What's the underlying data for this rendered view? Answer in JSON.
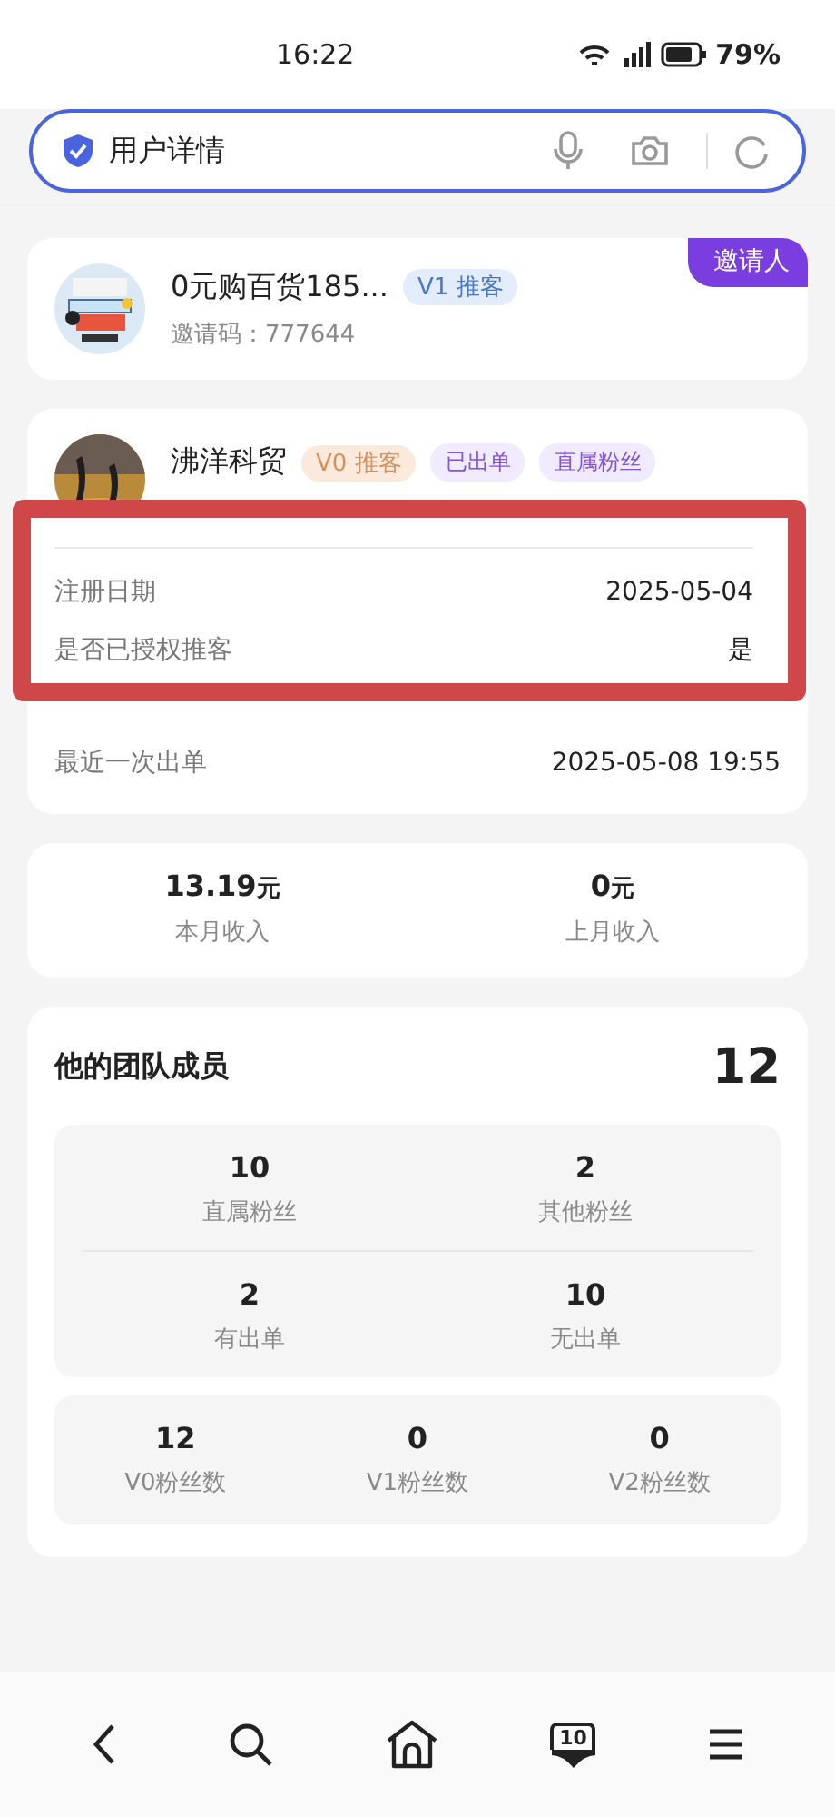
{
  "status_bar": {
    "time": "16:22",
    "battery": "79%"
  },
  "search": {
    "value": "用户详情"
  },
  "inviter": {
    "name": "0元购百货185...",
    "level": "V1",
    "role": "推客",
    "invite_code": "邀请码：777644",
    "ribbon": "邀请人"
  },
  "member": {
    "name": "沸洋科贸",
    "level": "V0",
    "role": "推客",
    "tags": [
      "已出单",
      "直属粉丝"
    ]
  },
  "highlight": {
    "rows": [
      {
        "label": "注册日期",
        "value": "2025-05-04"
      },
      {
        "label": "是否已授权推客",
        "value": "是"
      }
    ]
  },
  "detail_rows": [
    {
      "label": "最近一次出单",
      "value": "2025-05-08 19:55"
    }
  ],
  "income": [
    {
      "amount": "13.19",
      "unit": "元",
      "label": "本月收入"
    },
    {
      "amount": "0",
      "unit": "元",
      "label": "上月收入"
    }
  ],
  "team": {
    "title": "他的团队成员",
    "total": "12",
    "grid": [
      {
        "value": "10",
        "label": "直属粉丝"
      },
      {
        "value": "2",
        "label": "其他粉丝"
      },
      {
        "value": "2",
        "label": "有出单"
      },
      {
        "value": "10",
        "label": "无出单"
      }
    ],
    "levels": [
      {
        "value": "12",
        "label": "V0粉丝数"
      },
      {
        "value": "0",
        "label": "V1粉丝数"
      },
      {
        "value": "0",
        "label": "V2粉丝数"
      }
    ]
  },
  "nav": [
    {
      "kind": "back"
    },
    {
      "kind": "search"
    },
    {
      "kind": "home"
    },
    {
      "kind": "tabs",
      "badge": "10"
    },
    {
      "kind": "menu"
    }
  ]
}
